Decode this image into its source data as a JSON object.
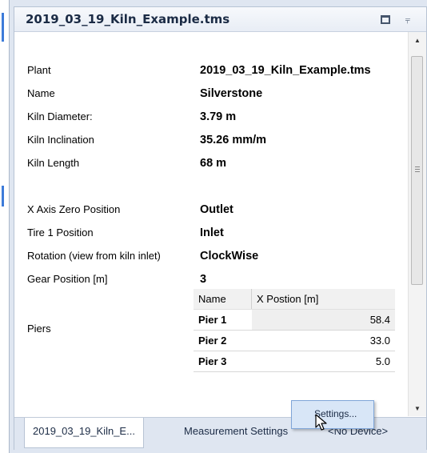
{
  "panel": {
    "title": "2019_03_19_Kiln_Example.tms"
  },
  "properties": [
    {
      "label": "Plant",
      "value": "2019_03_19_Kiln_Example.tms"
    },
    {
      "label": "Name",
      "value": "Silverstone"
    },
    {
      "label": "Kiln Diameter:",
      "value": "3.79 m"
    },
    {
      "label": "Kiln Inclination",
      "value": "35.26 mm/m"
    },
    {
      "label": "Kiln Length",
      "value": "68 m"
    },
    {
      "label": "X Axis Zero Position",
      "value": "Outlet"
    },
    {
      "label": "Tire 1 Position",
      "value": "Inlet"
    },
    {
      "label": "Rotation (view from kiln inlet)",
      "value": "ClockWise"
    },
    {
      "label": "Gear Position [m]",
      "value": "3"
    }
  ],
  "piers": {
    "label": "Piers",
    "columns": [
      "Name",
      "X Postion [m]"
    ],
    "rows": [
      {
        "name": "Pier 1",
        "x": "58.4"
      },
      {
        "name": "Pier 2",
        "x": "33.0"
      },
      {
        "name": "Pier 3",
        "x": "5.0"
      }
    ]
  },
  "tabs": [
    {
      "label": "2019_03_19_Kiln_E...",
      "active": true
    },
    {
      "label": "Measurement Settings",
      "active": false
    },
    {
      "label": "<No Device>",
      "active": false
    }
  ],
  "context_menu": {
    "item": "Settings..."
  },
  "colors": {
    "accent": "#3d7bd9",
    "menu_highlight": "#d8e6f7"
  }
}
